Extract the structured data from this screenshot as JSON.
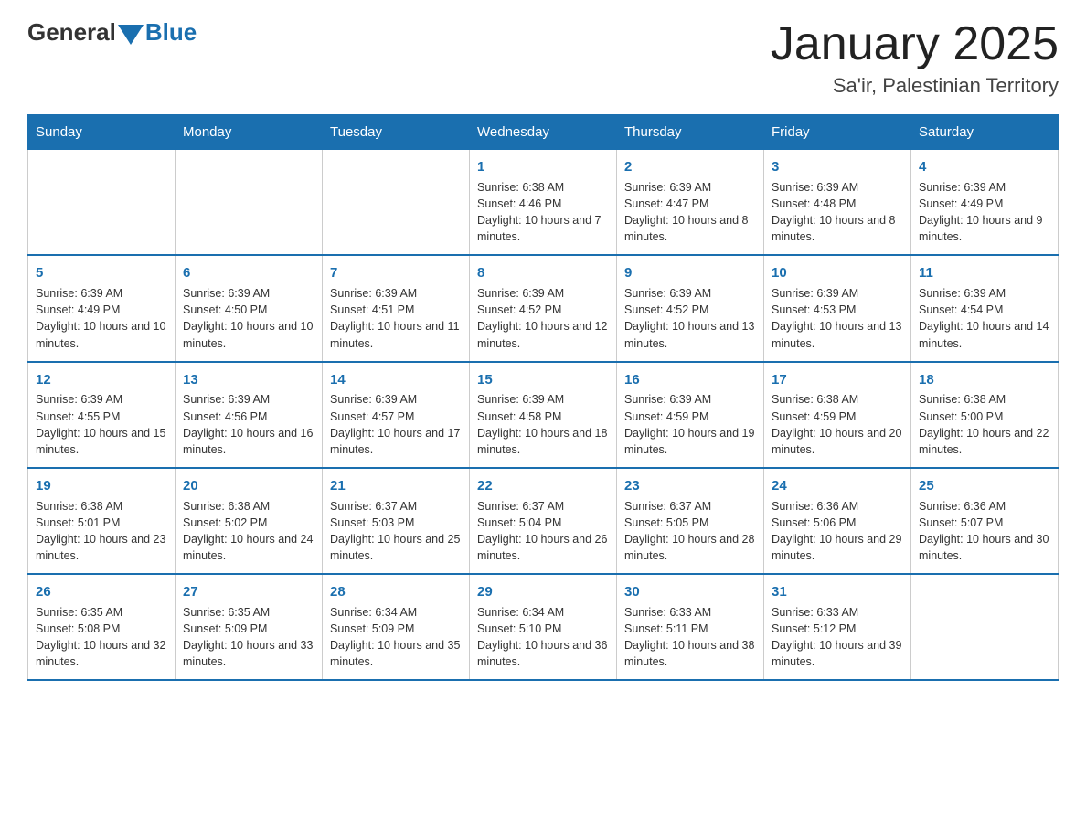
{
  "header": {
    "logo_general": "General",
    "logo_blue": "Blue",
    "month_title": "January 2025",
    "location": "Sa'ir, Palestinian Territory"
  },
  "days_of_week": [
    "Sunday",
    "Monday",
    "Tuesday",
    "Wednesday",
    "Thursday",
    "Friday",
    "Saturday"
  ],
  "weeks": [
    [
      {
        "num": "",
        "info": ""
      },
      {
        "num": "",
        "info": ""
      },
      {
        "num": "",
        "info": ""
      },
      {
        "num": "1",
        "info": "Sunrise: 6:38 AM\nSunset: 4:46 PM\nDaylight: 10 hours and 7 minutes."
      },
      {
        "num": "2",
        "info": "Sunrise: 6:39 AM\nSunset: 4:47 PM\nDaylight: 10 hours and 8 minutes."
      },
      {
        "num": "3",
        "info": "Sunrise: 6:39 AM\nSunset: 4:48 PM\nDaylight: 10 hours and 8 minutes."
      },
      {
        "num": "4",
        "info": "Sunrise: 6:39 AM\nSunset: 4:49 PM\nDaylight: 10 hours and 9 minutes."
      }
    ],
    [
      {
        "num": "5",
        "info": "Sunrise: 6:39 AM\nSunset: 4:49 PM\nDaylight: 10 hours and 10 minutes."
      },
      {
        "num": "6",
        "info": "Sunrise: 6:39 AM\nSunset: 4:50 PM\nDaylight: 10 hours and 10 minutes."
      },
      {
        "num": "7",
        "info": "Sunrise: 6:39 AM\nSunset: 4:51 PM\nDaylight: 10 hours and 11 minutes."
      },
      {
        "num": "8",
        "info": "Sunrise: 6:39 AM\nSunset: 4:52 PM\nDaylight: 10 hours and 12 minutes."
      },
      {
        "num": "9",
        "info": "Sunrise: 6:39 AM\nSunset: 4:52 PM\nDaylight: 10 hours and 13 minutes."
      },
      {
        "num": "10",
        "info": "Sunrise: 6:39 AM\nSunset: 4:53 PM\nDaylight: 10 hours and 13 minutes."
      },
      {
        "num": "11",
        "info": "Sunrise: 6:39 AM\nSunset: 4:54 PM\nDaylight: 10 hours and 14 minutes."
      }
    ],
    [
      {
        "num": "12",
        "info": "Sunrise: 6:39 AM\nSunset: 4:55 PM\nDaylight: 10 hours and 15 minutes."
      },
      {
        "num": "13",
        "info": "Sunrise: 6:39 AM\nSunset: 4:56 PM\nDaylight: 10 hours and 16 minutes."
      },
      {
        "num": "14",
        "info": "Sunrise: 6:39 AM\nSunset: 4:57 PM\nDaylight: 10 hours and 17 minutes."
      },
      {
        "num": "15",
        "info": "Sunrise: 6:39 AM\nSunset: 4:58 PM\nDaylight: 10 hours and 18 minutes."
      },
      {
        "num": "16",
        "info": "Sunrise: 6:39 AM\nSunset: 4:59 PM\nDaylight: 10 hours and 19 minutes."
      },
      {
        "num": "17",
        "info": "Sunrise: 6:38 AM\nSunset: 4:59 PM\nDaylight: 10 hours and 20 minutes."
      },
      {
        "num": "18",
        "info": "Sunrise: 6:38 AM\nSunset: 5:00 PM\nDaylight: 10 hours and 22 minutes."
      }
    ],
    [
      {
        "num": "19",
        "info": "Sunrise: 6:38 AM\nSunset: 5:01 PM\nDaylight: 10 hours and 23 minutes."
      },
      {
        "num": "20",
        "info": "Sunrise: 6:38 AM\nSunset: 5:02 PM\nDaylight: 10 hours and 24 minutes."
      },
      {
        "num": "21",
        "info": "Sunrise: 6:37 AM\nSunset: 5:03 PM\nDaylight: 10 hours and 25 minutes."
      },
      {
        "num": "22",
        "info": "Sunrise: 6:37 AM\nSunset: 5:04 PM\nDaylight: 10 hours and 26 minutes."
      },
      {
        "num": "23",
        "info": "Sunrise: 6:37 AM\nSunset: 5:05 PM\nDaylight: 10 hours and 28 minutes."
      },
      {
        "num": "24",
        "info": "Sunrise: 6:36 AM\nSunset: 5:06 PM\nDaylight: 10 hours and 29 minutes."
      },
      {
        "num": "25",
        "info": "Sunrise: 6:36 AM\nSunset: 5:07 PM\nDaylight: 10 hours and 30 minutes."
      }
    ],
    [
      {
        "num": "26",
        "info": "Sunrise: 6:35 AM\nSunset: 5:08 PM\nDaylight: 10 hours and 32 minutes."
      },
      {
        "num": "27",
        "info": "Sunrise: 6:35 AM\nSunset: 5:09 PM\nDaylight: 10 hours and 33 minutes."
      },
      {
        "num": "28",
        "info": "Sunrise: 6:34 AM\nSunset: 5:09 PM\nDaylight: 10 hours and 35 minutes."
      },
      {
        "num": "29",
        "info": "Sunrise: 6:34 AM\nSunset: 5:10 PM\nDaylight: 10 hours and 36 minutes."
      },
      {
        "num": "30",
        "info": "Sunrise: 6:33 AM\nSunset: 5:11 PM\nDaylight: 10 hours and 38 minutes."
      },
      {
        "num": "31",
        "info": "Sunrise: 6:33 AM\nSunset: 5:12 PM\nDaylight: 10 hours and 39 minutes."
      },
      {
        "num": "",
        "info": ""
      }
    ]
  ]
}
